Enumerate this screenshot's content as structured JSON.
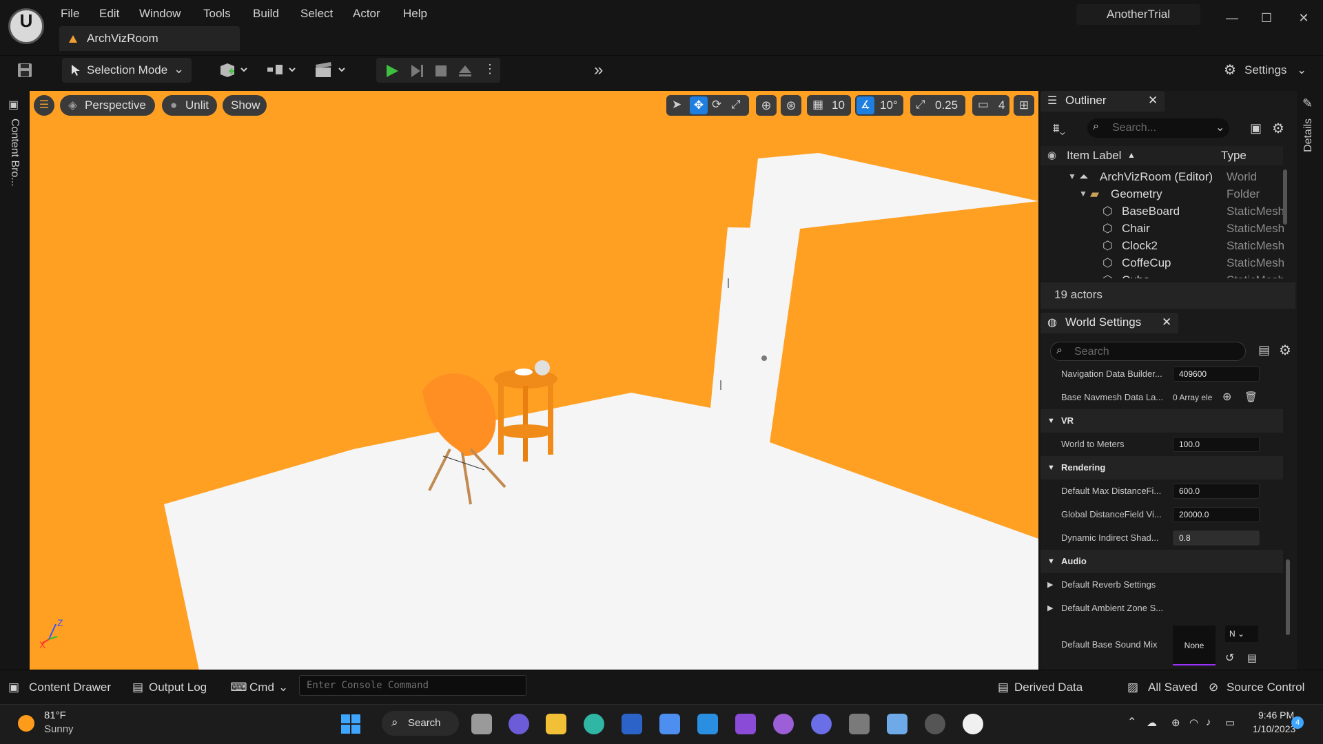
{
  "menu": {
    "items": [
      "File",
      "Edit",
      "Window",
      "Tools",
      "Build",
      "Select",
      "Actor",
      "Help"
    ]
  },
  "document_tab": "ArchVizRoom",
  "project_name": "AnotherTrial",
  "toolbar": {
    "selection_mode": "Selection Mode",
    "settings": "Settings"
  },
  "left_drawer_label": "Content Bro...",
  "viewport": {
    "perspective": "Perspective",
    "unlit": "Unlit",
    "show": "Show",
    "grid_snap": "10",
    "rotation_snap": "10°",
    "scale_snap": "0.25",
    "camera_speed": "4",
    "axis_z": "Z",
    "axis_x": "X"
  },
  "outliner": {
    "title": "Outliner",
    "search_placeholder": "Search...",
    "col_label": "Item Label",
    "col_type": "Type",
    "rows": [
      {
        "name": "ArchVizRoom (Editor)",
        "type": "World"
      },
      {
        "name": "Geometry",
        "type": "Folder"
      },
      {
        "name": "BaseBoard",
        "type": "StaticMesh"
      },
      {
        "name": "Chair",
        "type": "StaticMesh"
      },
      {
        "name": "Clock2",
        "type": "StaticMesh"
      },
      {
        "name": "CoffeCup",
        "type": "StaticMesh"
      },
      {
        "name": "Cube",
        "type": "StaticMesh"
      }
    ],
    "actor_count": "19 actors"
  },
  "world_settings": {
    "title": "World Settings",
    "search_placeholder": "Search",
    "props_top": [
      {
        "label": "Navigation Data Builder...",
        "value": "409600"
      },
      {
        "label": "Base Navmesh Data La...",
        "value": "0 Array ele"
      }
    ],
    "vr_section": "VR",
    "vr_props": [
      {
        "label": "World to Meters",
        "value": "100.0"
      }
    ],
    "rendering_section": "Rendering",
    "rendering_props": [
      {
        "label": "Default Max DistanceFi...",
        "value": "600.0"
      },
      {
        "label": "Global DistanceField Vi...",
        "value": "20000.0"
      },
      {
        "label": "Dynamic Indirect Shad...",
        "value": "0.8"
      }
    ],
    "audio_section": "Audio",
    "audio_props": [
      {
        "label": "Default Reverb Settings"
      },
      {
        "label": "Default Ambient Zone S..."
      },
      {
        "label": "Default Base Sound Mix",
        "value": "None",
        "dropdown": "N"
      }
    ]
  },
  "details_label": "Details",
  "statusbar": {
    "content_drawer": "Content Drawer",
    "output_log": "Output Log",
    "cmd": "Cmd",
    "console_placeholder": "Enter Console Command",
    "derived_data": "Derived Data",
    "all_saved": "All Saved",
    "source_control": "Source Control"
  },
  "taskbar": {
    "weather_temp": "81°F",
    "weather_desc": "Sunny",
    "search": "Search",
    "time": "9:46 PM",
    "date": "1/10/2023",
    "notifications": "4"
  },
  "colors": {
    "wall": "#ffa023",
    "floor": "#f5f5f5",
    "accent_play": "#3fbf3f",
    "active_blue": "#1f7fe0"
  }
}
